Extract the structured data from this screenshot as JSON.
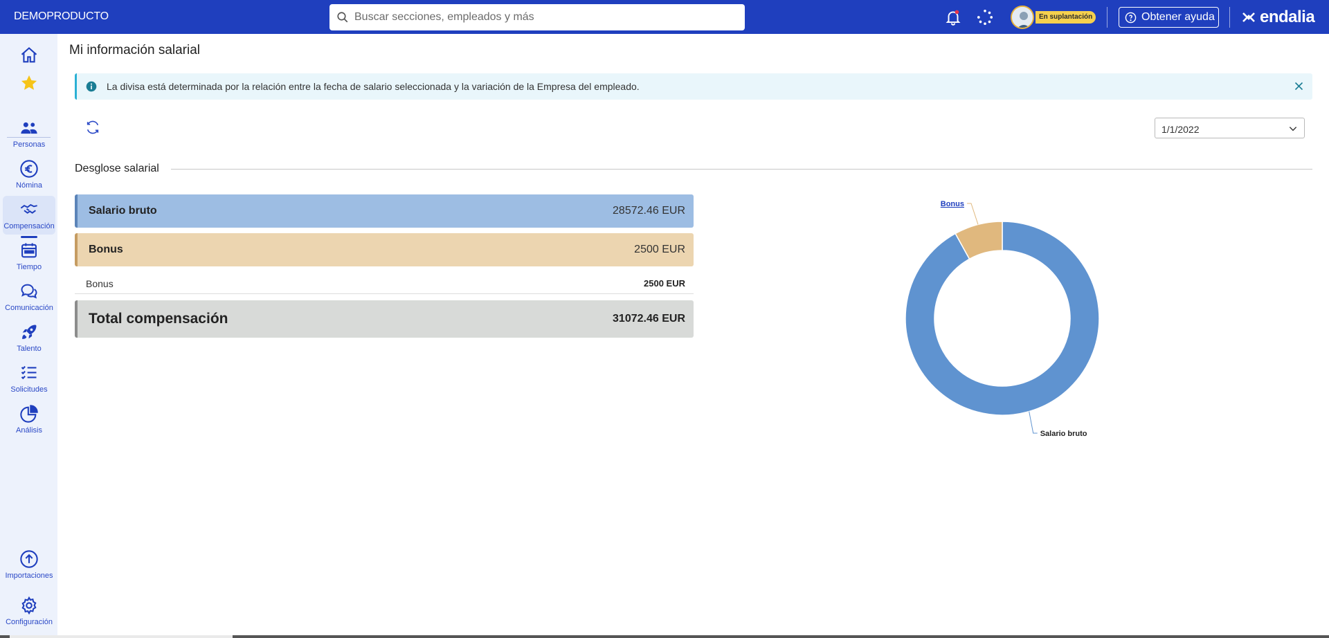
{
  "header": {
    "brand": "DEMOPRODUCTO",
    "search_placeholder": "Buscar secciones, empleados y más",
    "impersonation_badge": "En suplantación",
    "help_label": "Obtener ayuda",
    "logo_text": "endalia",
    "accent_color": "#1f3fbe"
  },
  "sidebar": {
    "items": [
      {
        "label": "",
        "icon": "home-icon"
      },
      {
        "label": "",
        "icon": "star-icon"
      },
      {
        "label": "Personas",
        "icon": "people-icon"
      },
      {
        "label": "Nómina",
        "icon": "euro-icon"
      },
      {
        "label": "Compensación",
        "icon": "handshake-icon",
        "active": true
      },
      {
        "label": "Tiempo",
        "icon": "calendar-icon"
      },
      {
        "label": "Comunicación",
        "icon": "chat-icon"
      },
      {
        "label": "Talento",
        "icon": "rocket-icon"
      },
      {
        "label": "Solicitudes",
        "icon": "checklist-icon"
      },
      {
        "label": "Análisis",
        "icon": "pie-chart-icon"
      },
      {
        "label": "Importaciones",
        "icon": "upload-icon"
      },
      {
        "label": "Configuración",
        "icon": "gear-icon"
      }
    ]
  },
  "page": {
    "title": "Mi información salarial",
    "alert_message": "La divisa está determinada por la relación entre la fecha de salario seleccionada y la variación de la Empresa del empleado.",
    "date_value": "1/1/2022",
    "section_title": "Desglose salarial"
  },
  "breakdown": {
    "salary": {
      "label": "Salario bruto",
      "amount": "28572.46 EUR"
    },
    "bonus": {
      "label": "Bonus",
      "amount": "2500 EUR"
    },
    "bonus_detail": {
      "label": "Bonus",
      "amount": "2500 EUR"
    },
    "total": {
      "label": "Total compensación",
      "amount": "31072.46 EUR"
    }
  },
  "chart_data": {
    "type": "pie",
    "style": "donut",
    "categories": [
      "Salario bruto",
      "Bonus"
    ],
    "values": [
      28572.46,
      2500
    ],
    "colors": [
      "#5f93d0",
      "#e0b87e"
    ],
    "title": ""
  }
}
